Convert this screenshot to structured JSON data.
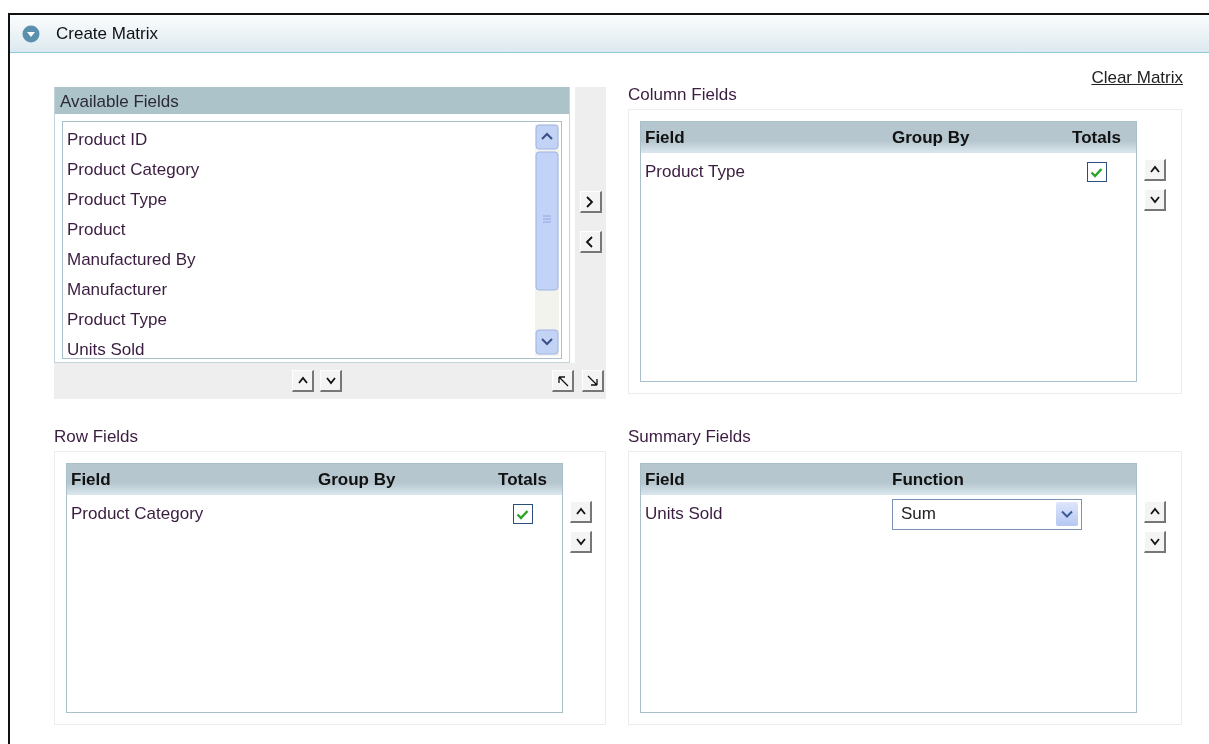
{
  "panel": {
    "title": "Create Matrix",
    "expanded": true
  },
  "clear_link": "Clear Matrix",
  "available_fields": {
    "title": "Available Fields",
    "items": [
      {
        "label": "Product ID",
        "selected": false
      },
      {
        "label": "Product Category",
        "selected": false
      },
      {
        "label": "Product Type",
        "selected": false
      },
      {
        "label": "Product",
        "selected": false
      },
      {
        "label": "Manufactured By",
        "selected": false
      },
      {
        "label": "Manufacturer",
        "selected": false
      },
      {
        "label": "Product Type",
        "selected": false
      },
      {
        "label": "Units Sold",
        "selected": false
      }
    ]
  },
  "column_fields": {
    "title": "Column Fields",
    "columns": [
      "Field",
      "Group By",
      "Totals"
    ],
    "rows": [
      {
        "field": "Product Type",
        "totals": true
      }
    ]
  },
  "row_fields": {
    "title": "Row Fields",
    "columns": [
      "Field",
      "Group By",
      "Totals"
    ],
    "rows": [
      {
        "field": "Product Category",
        "totals": true
      }
    ]
  },
  "summary_fields": {
    "title": "Summary Fields",
    "columns": [
      "Field",
      "Function"
    ],
    "rows": [
      {
        "field": "Units Sold",
        "function": "Sum"
      }
    ]
  }
}
